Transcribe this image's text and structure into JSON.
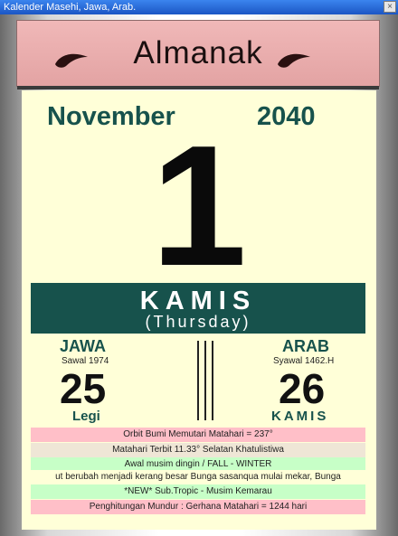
{
  "window": {
    "title": "Kalender Masehi, Jawa, Arab.",
    "close_glyph": "×"
  },
  "header": {
    "brand": "Almanak",
    "leaf_icon": "leaf-icon",
    "colors": {
      "band": "#e6a6a6",
      "leaf": "#2a1010"
    }
  },
  "calendar": {
    "month": "November",
    "year": "2040",
    "day": "1",
    "dayname": "KAMIS",
    "dayname_en": "(Thursday)",
    "jawa": {
      "label": "JAWA",
      "month": "Sawal  1974",
      "day": "25",
      "pasaran": "Legi"
    },
    "arab": {
      "label": "ARAB",
      "month": "Syawal  1462.H",
      "day": "26",
      "dayname": "KAMIS"
    }
  },
  "info_lines": [
    {
      "text": "Orbit Bumi Memutari Matahari = 237°",
      "color": "#ffbfc8"
    },
    {
      "text": "Matahari Terbit 11.33° Selatan Khatulistiwa",
      "color": "#efe6d6"
    },
    {
      "text": "Awal musim dingin / FALL - WINTER",
      "color": "#c7ffc7"
    },
    {
      "text": "ut berubah menjadi kerang besar Bunga sasanqua mulai mekar, Bunga",
      "color": "#ffffd8"
    },
    {
      "text": "*NEW* Sub.Tropic - Musim Kemarau",
      "color": "#c7ffc7"
    },
    {
      "text": "Penghitungan Mundur : Gerhana Matahari = 1244 hari",
      "color": "#ffbfc8"
    }
  ],
  "colors": {
    "accent": "#17524c",
    "page": "#ffffd8"
  }
}
